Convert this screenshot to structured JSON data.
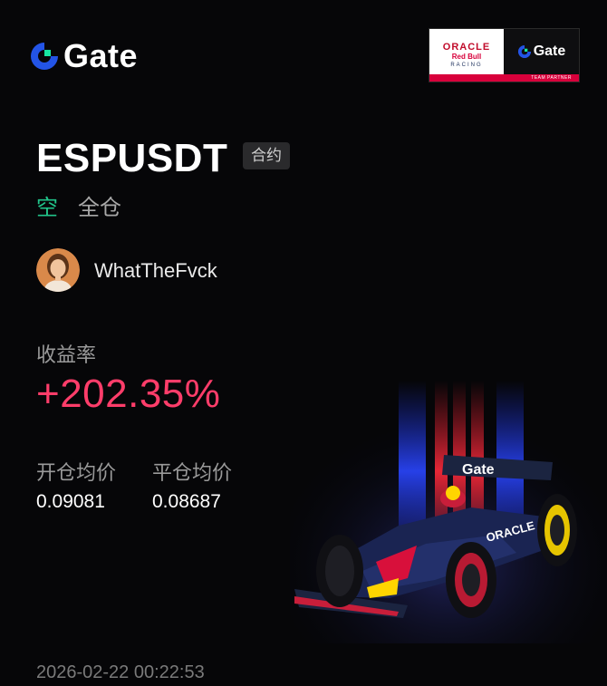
{
  "brand": {
    "name": "Gate",
    "logo_icon": "gate-logo-icon"
  },
  "partner_badge": {
    "oracle": "ORACLE",
    "redbull": "Red Bull",
    "racing": "RACING",
    "gate": "Gate",
    "tagline": "TEAM PARTNER"
  },
  "position": {
    "symbol": "ESPUSDT",
    "type_tag": "合约",
    "side": "空",
    "margin_mode": "全仓"
  },
  "user": {
    "name": "WhatTheFvck",
    "avatar_icon": "user-avatar"
  },
  "stats": {
    "roi_label": "收益率",
    "roi_value": "+202.35%",
    "open_label": "开仓均价",
    "open_value": "0.09081",
    "close_label": "平仓均价",
    "close_value": "0.08687"
  },
  "timestamp": "2026-02-22 00:22:53",
  "colors": {
    "background": "#060608",
    "long_short": "#21c48a",
    "profit": "#ff3d6a",
    "brand_blue": "#2354e6",
    "brand_green": "#17e6a1"
  }
}
